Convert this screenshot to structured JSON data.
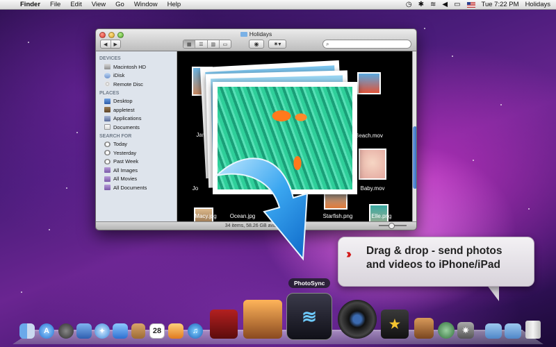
{
  "menubar": {
    "app_name": "Finder",
    "menus": [
      "File",
      "Edit",
      "View",
      "Go",
      "Window",
      "Help"
    ],
    "clock": "Tue 7:22 PM",
    "user": "Holidays"
  },
  "finder": {
    "window_title": "Holidays",
    "search_placeholder": "",
    "status_text": "34 items, 58.26 GB available",
    "sidebar": {
      "devices_label": "DEVICES",
      "devices": [
        "Macintosh HD",
        "iDisk",
        "Remote Disc"
      ],
      "places_label": "PLACES",
      "places": [
        "Desktop",
        "appletest",
        "Applications",
        "Documents"
      ],
      "search_label": "SEARCH FOR",
      "searches": [
        "Today",
        "Yesterday",
        "Past Week",
        "All Images",
        "All Movies",
        "All Documents"
      ]
    },
    "files": [
      {
        "label": "Jana"
      },
      {
        "label": "Beach.mov"
      },
      {
        "label": "Jo"
      },
      {
        "label": "Baby.mov"
      },
      {
        "label": "Macy.jpg"
      },
      {
        "label": "Ocean.jpg"
      },
      {
        "label": "Z"
      },
      {
        "label": "Starfish.png"
      },
      {
        "label": "Elle.png"
      }
    ]
  },
  "callout": {
    "line1": "Drag & drop - send photos",
    "line2": "and videos to iPhone/iPad"
  },
  "dock": {
    "tooltip": "PhotoSync",
    "calendar_day": "28"
  }
}
